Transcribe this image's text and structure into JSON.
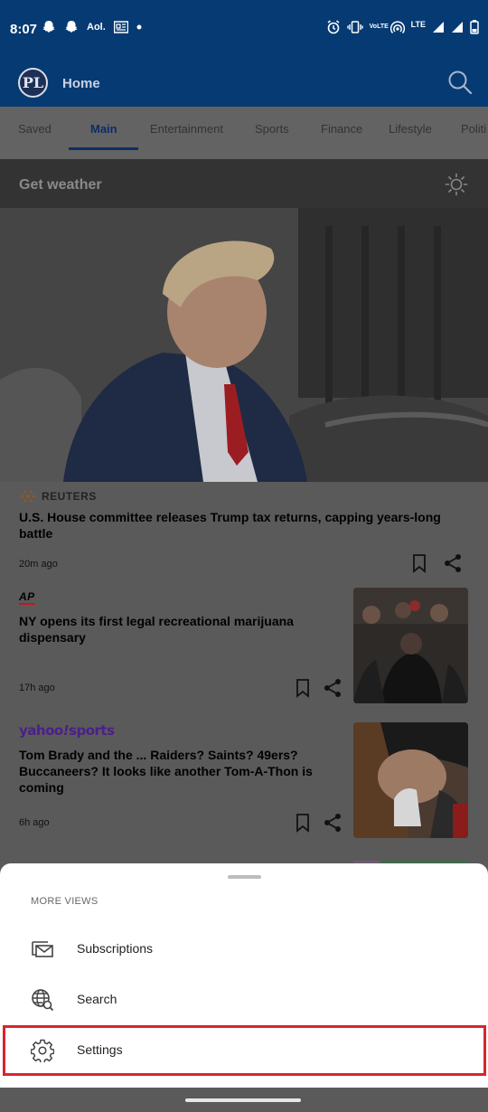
{
  "status_bar": {
    "time": "8:07",
    "left_icons": [
      "snapchat-icon",
      "snapchat-icon",
      "aol-icon",
      "news-icon",
      "dot-icon"
    ],
    "aol_label": "Aol.",
    "right_icons": [
      "alarm-icon",
      "vibrate-icon",
      "volte-icon",
      "hotspot-icon",
      "signal-icon",
      "battery-icon"
    ],
    "volte_label": "VoLTE",
    "lte_label": "LTE"
  },
  "header": {
    "avatar_initials": "PL",
    "title": "Home"
  },
  "tabs": [
    {
      "label": "Saved"
    },
    {
      "label": "Main",
      "active": true
    },
    {
      "label": "Entertainment"
    },
    {
      "label": "Sports"
    },
    {
      "label": "Finance"
    },
    {
      "label": "Lifestyle"
    },
    {
      "label": "Politi"
    }
  ],
  "weather": {
    "label": "Get weather"
  },
  "articles": [
    {
      "source": "REUTERS",
      "headline_lines": [
        "U.S. House committee releases Trump tax returns, capping years-long",
        "battle"
      ],
      "time": "20m ago"
    },
    {
      "source": "AP",
      "headline_lines": [
        "NY opens its first legal recreational marijuana",
        "dispensary"
      ],
      "time": "17h ago"
    },
    {
      "source_prefix": "yahoo",
      "source_suffix": "sports",
      "headline_lines": [
        "Tom Brady and the ... Raiders? Saints? 49ers?",
        "Buccaneers? It looks like another Tom-A-Thon is",
        "coming"
      ],
      "time": "6h ago"
    }
  ],
  "sheet": {
    "heading": "MORE VIEWS",
    "items": [
      {
        "label": "Subscriptions",
        "icon": "subscriptions-icon"
      },
      {
        "label": "Search",
        "icon": "globe-search-icon"
      },
      {
        "label": "Settings",
        "icon": "gear-icon"
      }
    ]
  },
  "colors": {
    "header_blue": "#063a73",
    "highlight_red": "#d9242d",
    "yahoo_purple": "#4b1f8a",
    "ap_red": "#c0191f"
  }
}
